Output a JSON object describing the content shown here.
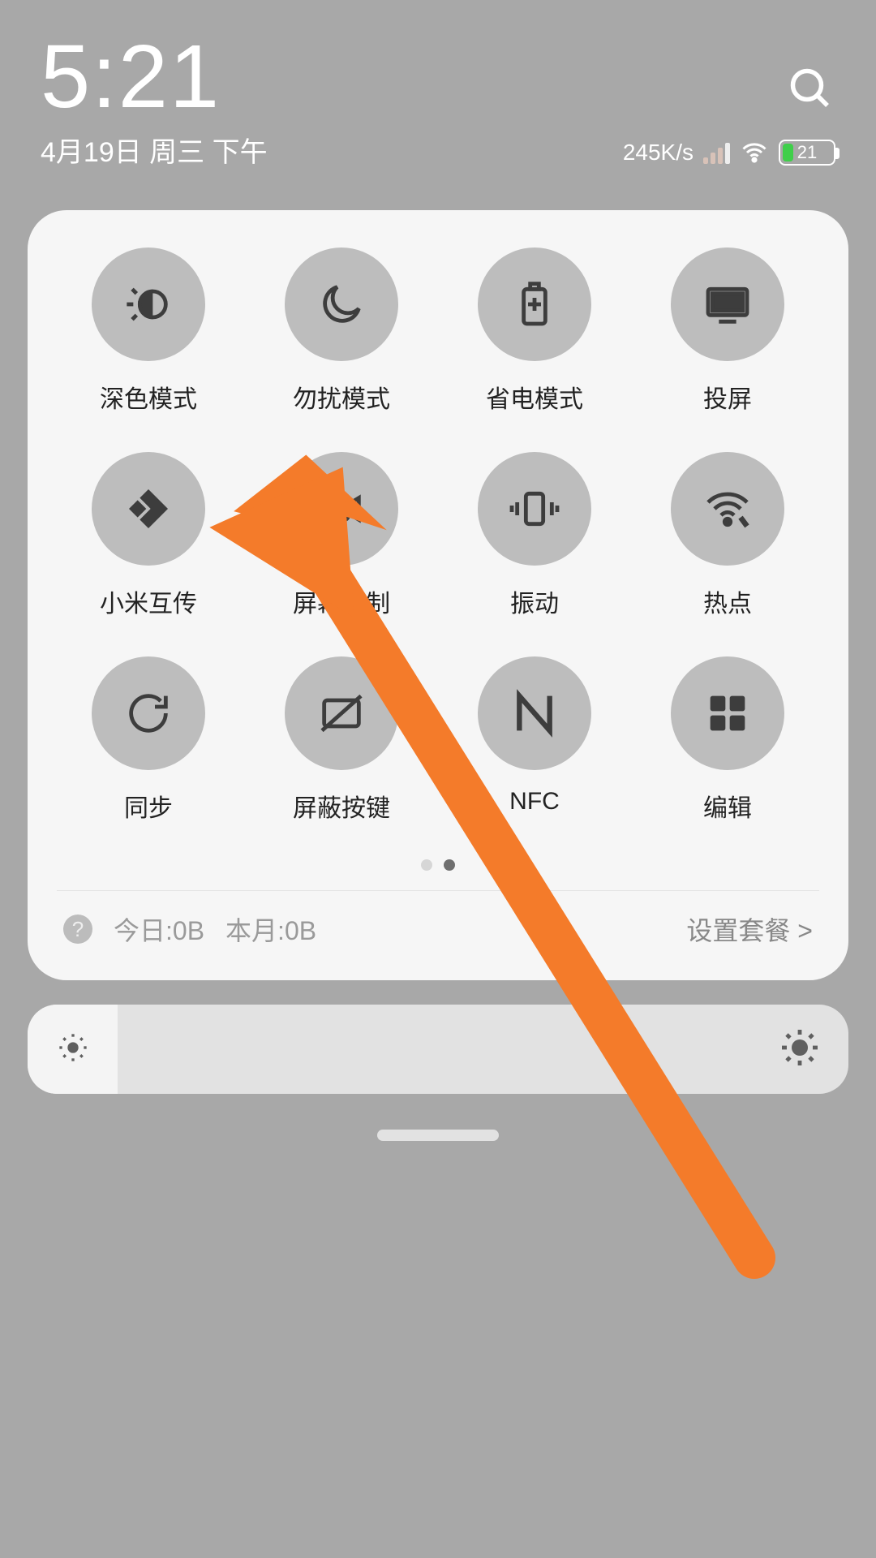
{
  "header": {
    "time": "5:21",
    "date": "4月19日 周三 下午",
    "net_speed": "245K/s",
    "battery_text": "21"
  },
  "toggles": [
    {
      "id": "dark-mode",
      "label": "深色模式"
    },
    {
      "id": "do-not-disturb",
      "label": "勿扰模式"
    },
    {
      "id": "power-save",
      "label": "省电模式"
    },
    {
      "id": "cast",
      "label": "投屏"
    },
    {
      "id": "mi-share",
      "label": "小米互传"
    },
    {
      "id": "screen-record",
      "label": "屏幕录制"
    },
    {
      "id": "vibrate",
      "label": "振动"
    },
    {
      "id": "hotspot",
      "label": "热点"
    },
    {
      "id": "sync",
      "label": "同步"
    },
    {
      "id": "hide-keys",
      "label": "屏蔽按键"
    },
    {
      "id": "nfc",
      "label": "NFC"
    },
    {
      "id": "edit",
      "label": "编辑"
    }
  ],
  "data_row": {
    "today": "今日:0B",
    "month": "本月:0B",
    "plan": "设置套餐 >"
  },
  "annotation": {
    "color": "#f47b2a"
  }
}
